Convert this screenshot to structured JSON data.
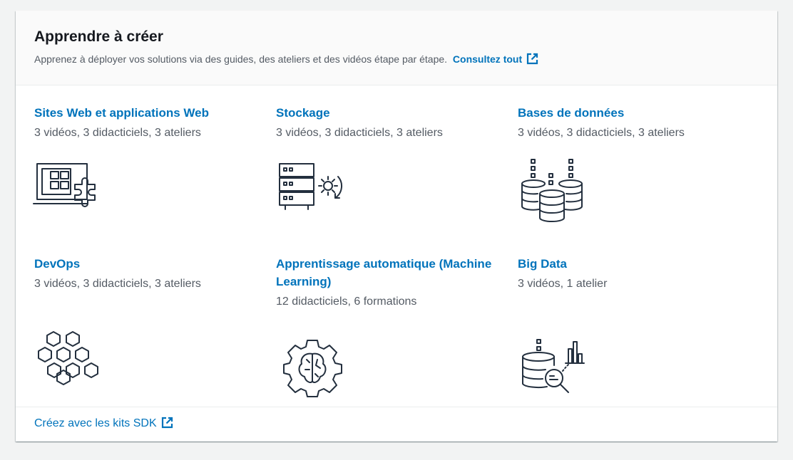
{
  "header": {
    "title": "Apprendre à créer",
    "subtitle": "Apprenez à déployer vos solutions via des guides, des ateliers et des vidéos étape par étape.",
    "view_all_label": "Consultez tout"
  },
  "tiles": [
    {
      "title": "Sites Web et applications Web",
      "desc": "3 vidéos, 3 didacticiels, 3 ateliers",
      "icon": "web-app-icon"
    },
    {
      "title": "Stockage",
      "desc": "3 vidéos, 3 didacticiels, 3 ateliers",
      "icon": "storage-icon"
    },
    {
      "title": "Bases de données",
      "desc": "3 vidéos, 3 didacticiels, 3 ateliers",
      "icon": "database-icon"
    },
    {
      "title": "DevOps",
      "desc": "3 vidéos, 3 didacticiels, 3 ateliers",
      "icon": "devops-icon"
    },
    {
      "title": "Apprentissage automatique (Machine Learning)",
      "desc": "12 didacticiels, 6 formations",
      "icon": "machine-learning-icon"
    },
    {
      "title": "Big Data",
      "desc": "3 vidéos, 1 atelier",
      "icon": "big-data-icon"
    }
  ],
  "footer": {
    "sdk_link_label": "Créez avec les kits SDK"
  },
  "colors": {
    "link": "#0073bb",
    "text": "#16191f",
    "secondary_text": "#545b64",
    "icon_stroke": "#232f3e",
    "page_background": "#f2f3f3"
  }
}
